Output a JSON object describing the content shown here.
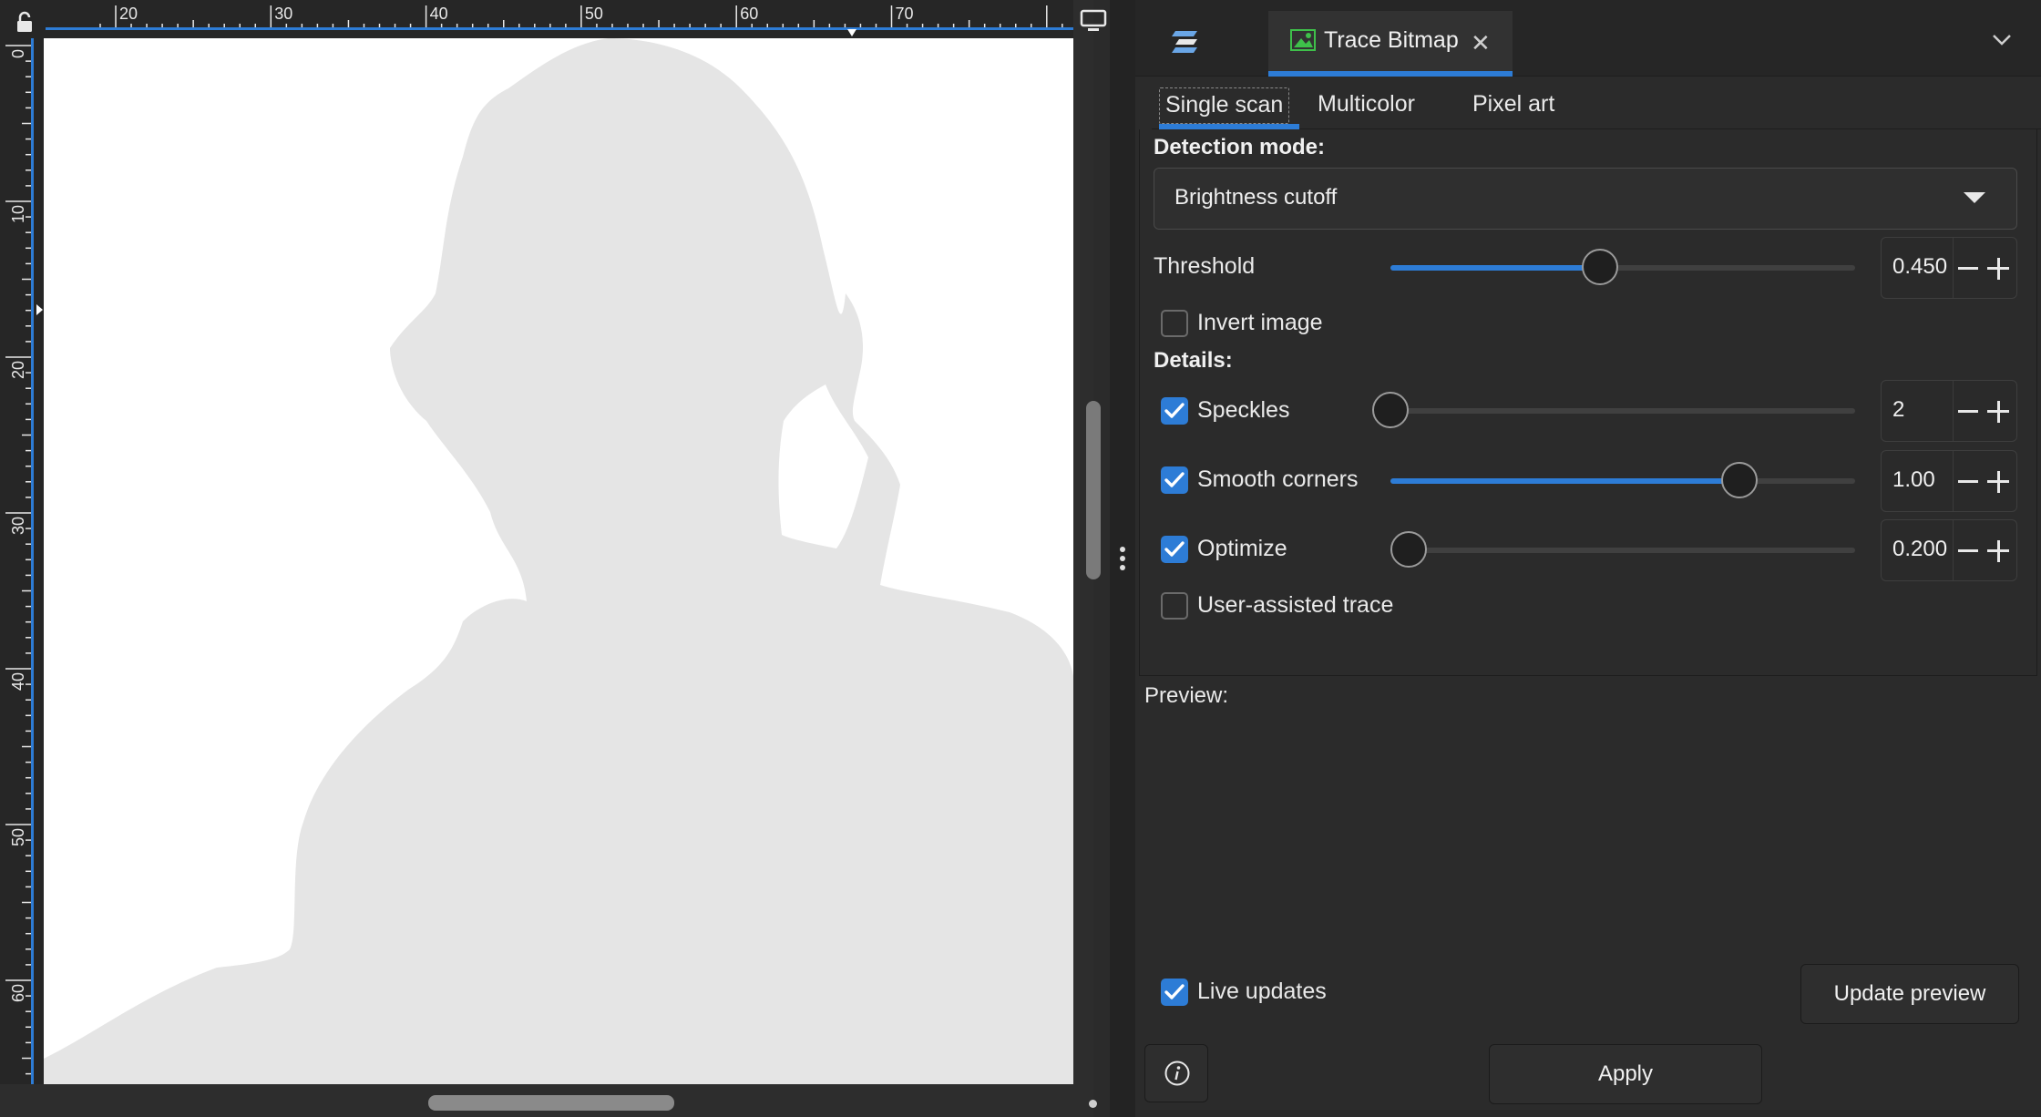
{
  "canvas": {
    "hruler_ticks": [
      "20",
      "30",
      "40",
      "50",
      "60",
      "70"
    ],
    "vruler_ticks": [
      "0",
      "10",
      "20",
      "30",
      "40",
      "50",
      "60"
    ]
  },
  "dock": {
    "tab_title": "Trace Bitmap",
    "tab_close": "✕"
  },
  "subtabs": {
    "single": "Single scan",
    "multi": "Multicolor",
    "pixel": "Pixel art"
  },
  "single_scan": {
    "detection_label": "Detection mode:",
    "detection_value": "Brightness cutoff",
    "threshold_label": "Threshold",
    "threshold_value": "0.450",
    "threshold_level": 0.45,
    "invert_label": "Invert image",
    "invert_checked": false,
    "details_label": "Details:",
    "speckles_label": "Speckles",
    "speckles_value": "2",
    "speckles_checked": true,
    "speckles_level": 0.0,
    "smooth_label": "Smooth corners",
    "smooth_value": "1.00",
    "smooth_checked": true,
    "smooth_level": 0.75,
    "optimize_label": "Optimize",
    "optimize_value": "0.200",
    "optimize_checked": true,
    "optimize_level": 0.04,
    "user_assisted_label": "User-assisted trace",
    "user_assisted_checked": false
  },
  "preview": {
    "label": "Preview:",
    "live_updates_label": "Live updates",
    "live_updates_checked": true,
    "update_preview_button": "Update preview"
  },
  "footer": {
    "apply_button": "Apply"
  },
  "colors": {
    "accent": "#2d7cd6",
    "canvas_bg": "#ffffff",
    "silhouette": "#e5e5e5"
  }
}
